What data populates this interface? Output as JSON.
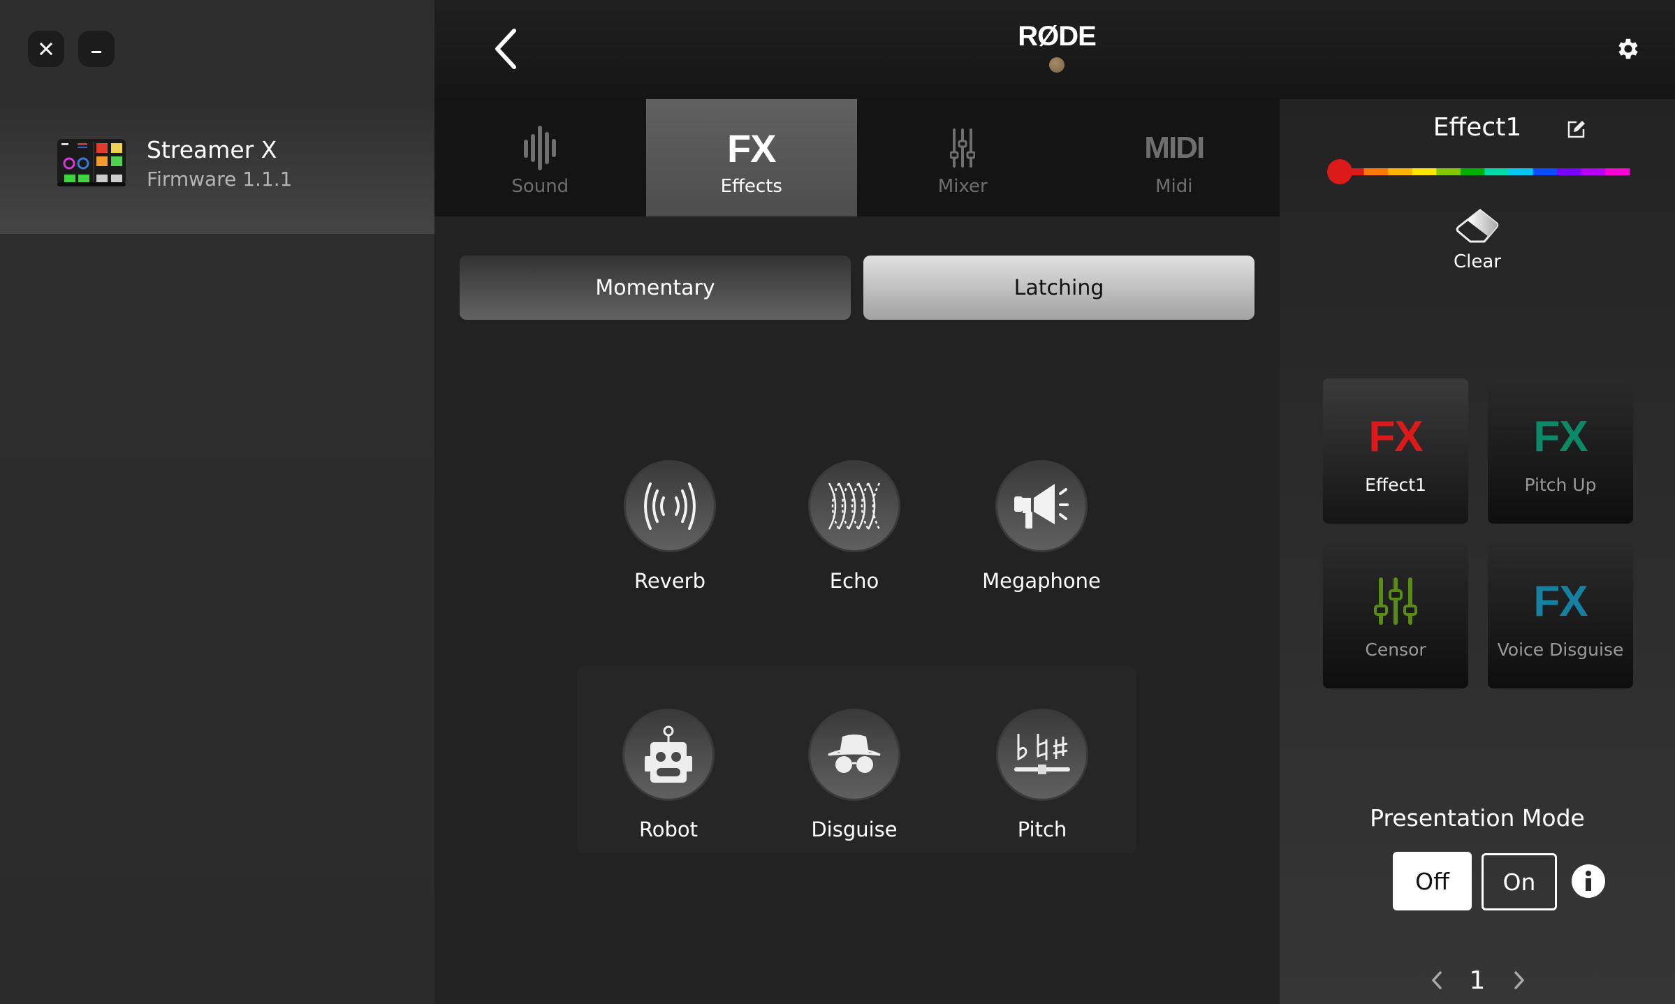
{
  "window_controls": {
    "close_icon": "close-icon",
    "minimize_icon": "minimize-icon"
  },
  "sidebar": {
    "device": {
      "name": "Streamer X",
      "firmware": "Firmware 1.1.1",
      "icon": "streamer-x-device-icon"
    }
  },
  "header": {
    "logo": "RØDE",
    "back_icon": "chevron-left-icon",
    "settings_icon": "gear-icon",
    "status_dot_color": "#8a7454"
  },
  "tabs": [
    {
      "label": "Sound",
      "icon": "sound-wave-icon",
      "active": false
    },
    {
      "label": "Effects",
      "icon": "fx-icon",
      "glyph": "FX",
      "active": true
    },
    {
      "label": "Mixer",
      "icon": "mixer-faders-icon",
      "active": false
    },
    {
      "label": "Midi",
      "icon": "midi-icon",
      "glyph": "MIDI",
      "active": false
    }
  ],
  "main": {
    "modes": [
      {
        "label": "Momentary",
        "selected": false
      },
      {
        "label": "Latching",
        "selected": true
      }
    ],
    "effects": [
      {
        "label": "Reverb",
        "icon": "reverb-icon"
      },
      {
        "label": "Echo",
        "icon": "echo-icon"
      },
      {
        "label": "Megaphone",
        "icon": "megaphone-icon"
      },
      {
        "label": "Robot",
        "icon": "robot-icon"
      },
      {
        "label": "Disguise",
        "icon": "disguise-icon"
      },
      {
        "label": "Pitch",
        "icon": "pitch-icon"
      }
    ]
  },
  "right_panel": {
    "pad_title": "Effect1",
    "edit_icon": "edit-icon",
    "color_slider": {
      "selected_index": 0,
      "colors": [
        "#dc1a1a",
        "#ff7a00",
        "#ffb300",
        "#ffe600",
        "#84c900",
        "#00b000",
        "#00d9a8",
        "#00c8f0",
        "#0a4cff",
        "#7a00ff",
        "#b800f5",
        "#ff00d4"
      ]
    },
    "clear_label": "Clear",
    "pads": [
      {
        "glyph": "FX",
        "label": "Effect1",
        "color": "#dc1a1a",
        "selected": true
      },
      {
        "glyph": "FX",
        "label": "Pitch Up",
        "color": "#0c8a68",
        "selected": false
      },
      {
        "glyph": "",
        "icon": "mixer-faders-icon",
        "label": "Censor",
        "color": "#5a8c14",
        "selected": false
      },
      {
        "glyph": "FX",
        "label": "Voice Disguise",
        "color": "#1580a0",
        "selected": false
      }
    ],
    "presentation_mode": {
      "label": "Presentation Mode",
      "off_label": "Off",
      "on_label": "On",
      "value": "Off"
    },
    "pager": {
      "page": "1",
      "prev": "‹",
      "next": "›"
    }
  }
}
